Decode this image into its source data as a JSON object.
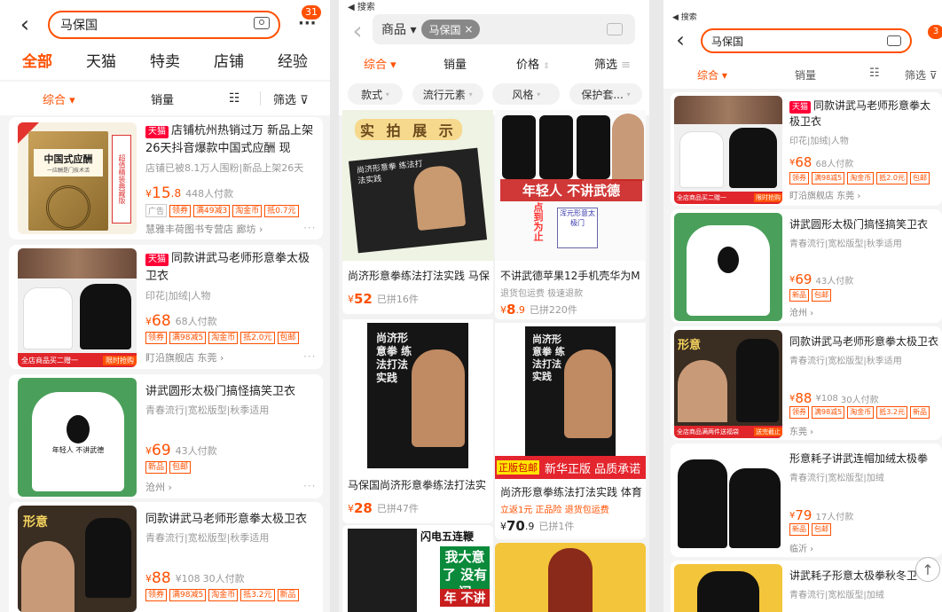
{
  "p1": {
    "search_value": "马保国",
    "badge": "31",
    "tabs": [
      "全部",
      "天猫",
      "特卖",
      "店铺",
      "经验"
    ],
    "sort": {
      "comprehensive": "综合",
      "sales": "销量",
      "filter": "筛选"
    },
    "items": [
      {
        "brand": "天猫",
        "title": "店铺杭州热销过万 新品上架26天抖音爆款中国式应酬 现",
        "sub": "店铺已被8.1万人围粉|新品上架26天",
        "price_sym": "¥",
        "price_int": "15",
        "price_dec": ".8",
        "sold": "448人付款",
        "ad": "广告",
        "tags": [
          "领券",
          "满49减3",
          "淘金币",
          "抵0.7元"
        ],
        "shop": "慧雅丰荷图书专营店",
        "loc": "廊坊",
        "cover_text": "中国式应酬",
        "cover_sub": "一应酬是门技术活",
        "side_text": "超值精装典藏版"
      },
      {
        "brand": "天猫",
        "title": "同款讲武马老师形意拳太极卫衣",
        "sub": "印花|加绒|人物",
        "price_sym": "¥",
        "price_int": "68",
        "sold": "68人付款",
        "tags": [
          "领券",
          "满98减5",
          "淘金币",
          "抵2.0元",
          "包邮"
        ],
        "shop": "盯沿旗舰店",
        "loc": "东莞",
        "banner": "全店商品买二赠一",
        "banner2": "限时抢购"
      },
      {
        "title": "讲武圆形太极门搞怪搞笑卫衣",
        "sub": "青春流行|宽松版型|秋季适用",
        "price_sym": "¥",
        "price_int": "69",
        "sold": "43人付款",
        "tags": [
          "新品",
          "包邮"
        ],
        "loc": "沧州",
        "print": "年轻人 不讲武德"
      },
      {
        "title": "同款讲武马老师形意拳太极卫衣",
        "sub": "青春流行|宽松版型|秋季适用",
        "price_sym": "¥",
        "price_int": "88",
        "orig": "¥108",
        "sold": "30人付款",
        "tags": [
          "领券",
          "满98减5",
          "淘金币",
          "抵3.2元",
          "新品"
        ],
        "poster": "形意"
      }
    ]
  },
  "p2": {
    "back": "◀ 搜索",
    "category": "商品",
    "chip": "马保国",
    "sort": {
      "comprehensive": "综合",
      "sales": "销量",
      "price": "价格",
      "filter": "筛选"
    },
    "filters": [
      "款式",
      "流行元素",
      "风格",
      "保护套..."
    ],
    "items": [
      {
        "title": "尚济形意拳练法打法实践 马保",
        "price_sym": "¥",
        "price_int": "52",
        "sold": "已拼16件",
        "banner": "实 拍 展 示",
        "book": "尚济形意拳 练法打法实践"
      },
      {
        "title": "不讲武德苹果12手机壳华为M",
        "sub": "退货包运费 极速退款",
        "price_sym": "¥",
        "price_int": "8",
        "price_dec": ".9",
        "sold": "已拼220件",
        "slogan": "年轻人 不讲武德",
        "stamp": "点到为止",
        "cname": "浑元形意太极门"
      },
      {
        "title": "马保国尚济形意拳练法打法实",
        "price_sym": "¥",
        "price_int": "28",
        "sold": "已拼47件",
        "book": "尚济形意拳 练法打法实践"
      },
      {
        "title": "尚济形意拳练法打法实践 体育",
        "sub": "立返1元 正品险 退货包运费",
        "price_sym": "¥",
        "price_int": "70",
        "price_dec": ".9",
        "sold": "已拼1件",
        "promo1": "正版包邮",
        "promo2": "新华正版 品质承诺",
        "book": "尚济形意拳 练法打法实践"
      },
      {
        "poster": "闪电五连鞭",
        "poster2": "我大意了 没有闪",
        "poster3": "年 不讲"
      }
    ]
  },
  "p3": {
    "back": "◀ 搜索",
    "search_value": "马保国",
    "badge": "3",
    "sort": {
      "comprehensive": "综合",
      "sales": "销量",
      "filter": "筛选"
    },
    "items": [
      {
        "brand": "天猫",
        "title": "同款讲武马老师形意拳太极卫衣",
        "sub": "印花|加绒|人物",
        "price_sym": "¥",
        "price_int": "68",
        "sold": "68人付款",
        "tags": [
          "领券",
          "满98减5",
          "淘金币",
          "抵2.0元",
          "包邮"
        ],
        "shop": "盯沿旗舰店",
        "loc": "东莞",
        "banner": "全店商品买二赠一",
        "banner2": "限时抢购"
      },
      {
        "title": "讲武圆形太极门搞怪搞笑卫衣",
        "sub": "青春流行|宽松版型|秋季适用",
        "price_sym": "¥",
        "price_int": "69",
        "sold": "43人付款",
        "tags": [
          "新品",
          "包邮"
        ],
        "loc": "沧州"
      },
      {
        "title": "同款讲武马老师形意拳太极卫衣",
        "sub": "青春流行|宽松版型|秋季适用",
        "price_sym": "¥",
        "price_int": "88",
        "orig": "¥108",
        "sold": "30人付款",
        "tags": [
          "领券",
          "满98减5",
          "淘金币",
          "抵3.2元",
          "新品"
        ],
        "loc": "东莞",
        "banner": "全店商品满两件送福袋",
        "banner2": "送完截止"
      },
      {
        "title": "形意耗子讲武连帽加绒太极拳",
        "sub": "青春流行|宽松版型|加绒",
        "price_sym": "¥",
        "price_int": "79",
        "sold": "17人付款",
        "tags": [
          "新品",
          "包邮"
        ],
        "loc": "临沂"
      },
      {
        "title": "讲武耗子形意太极拳秋冬卫",
        "sub": "青春流行|宽松版型|加绒"
      }
    ]
  },
  "colors": {
    "accent": "#ff5000",
    "tmall": "#ff0036"
  }
}
